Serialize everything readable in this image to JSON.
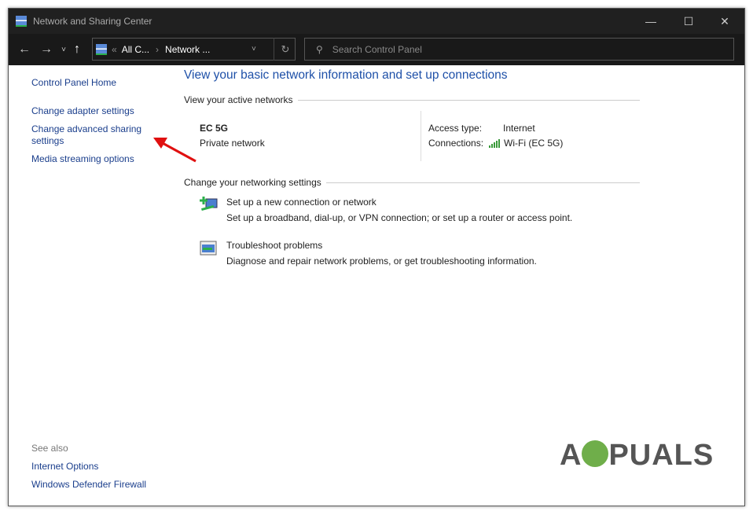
{
  "window": {
    "title": "Network and Sharing Center"
  },
  "nav": {
    "breadcrumb_prefix": "«",
    "crumb1": "All C...",
    "sep": "›",
    "crumb2": "Network ...",
    "search_placeholder": "Search Control Panel"
  },
  "sidebar": {
    "home": "Control Panel Home",
    "items": [
      "Change adapter settings",
      "Change advanced sharing settings",
      "Media streaming options"
    ],
    "see_also": "See also",
    "see_also_items": [
      "Internet Options",
      "Windows Defender Firewall"
    ]
  },
  "main": {
    "title": "View your basic network information and set up connections",
    "active_header": "View your active networks",
    "network_name": "EC 5G",
    "network_type": "Private network",
    "access_label": "Access type:",
    "access_value": "Internet",
    "connections_label": "Connections:",
    "connection_value": "Wi-Fi (EC 5G)",
    "change_header": "Change your networking settings",
    "tasks": [
      {
        "title": "Set up a new connection or network",
        "desc": "Set up a broadband, dial-up, or VPN connection; or set up a router or access point."
      },
      {
        "title": "Troubleshoot problems",
        "desc": "Diagnose and repair network problems, or get troubleshooting information."
      }
    ]
  },
  "watermark": "APPUALS"
}
